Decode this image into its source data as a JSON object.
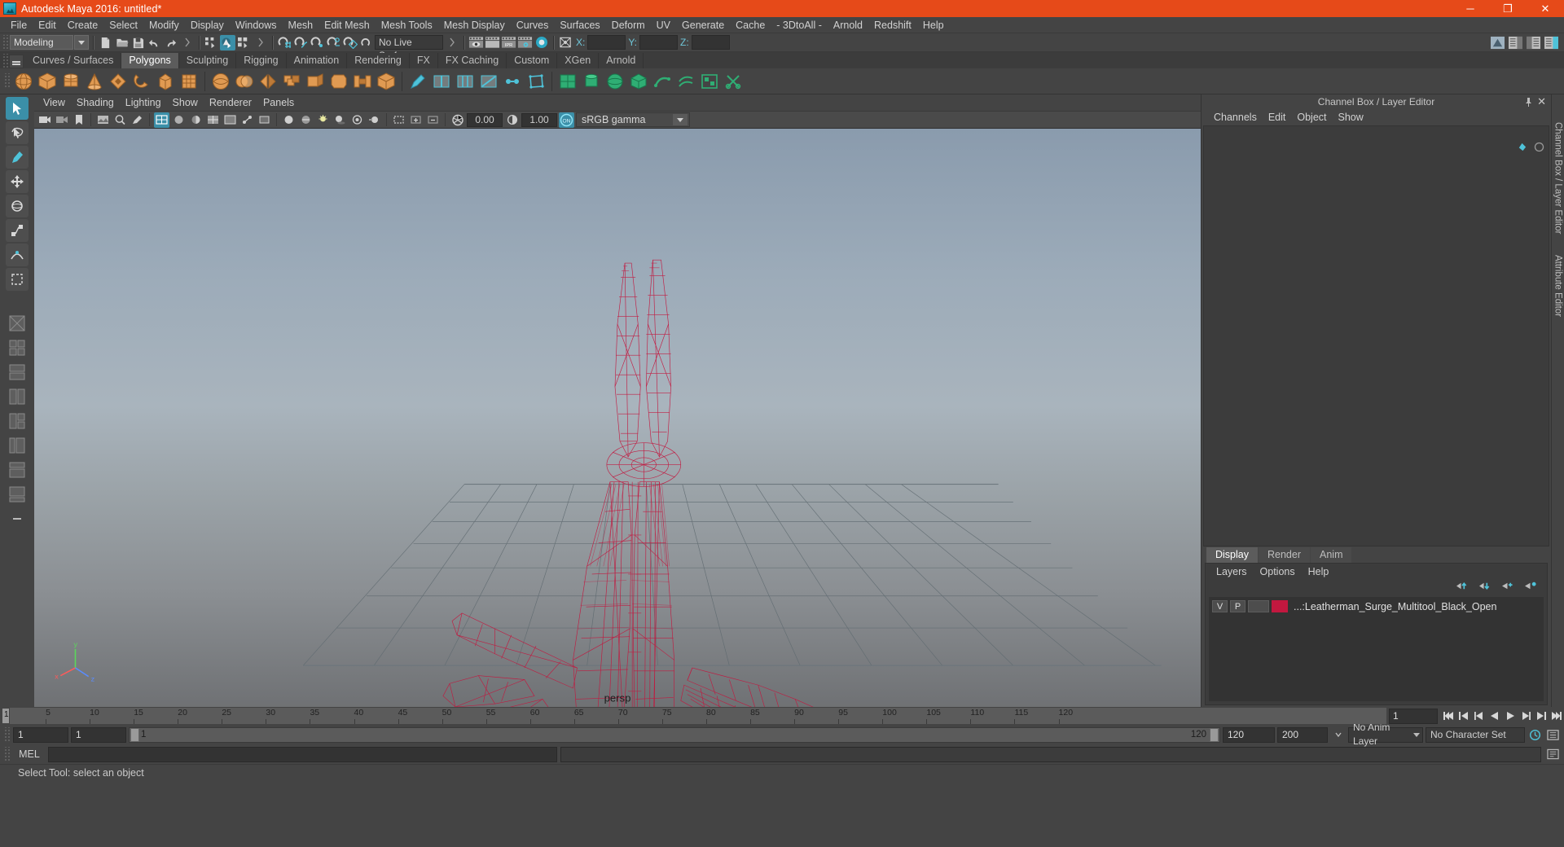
{
  "window": {
    "title": "Autodesk Maya 2016: untitled*",
    "logo_icon": "maya-logo-icon",
    "minimize_label": "─",
    "maximize_label": "❐",
    "close_label": "✕"
  },
  "menubar": {
    "items": [
      "File",
      "Edit",
      "Create",
      "Select",
      "Modify",
      "Display",
      "Windows",
      "Mesh",
      "Edit Mesh",
      "Mesh Tools",
      "Mesh Display",
      "Curves",
      "Surfaces",
      "Deform",
      "UV",
      "Generate",
      "Cache",
      "- 3DtoAll -",
      "Arnold",
      "Redshift",
      "Help"
    ]
  },
  "statusline": {
    "menuset": "Modeling",
    "live_surface": "No Live Surface",
    "coord_x_label": "X:",
    "coord_y_label": "Y:",
    "coord_z_label": "Z:",
    "coord_x_value": "",
    "coord_y_value": "",
    "coord_z_value": "",
    "ipr_label": "IPR"
  },
  "shelf": {
    "tabs": [
      "Curves / Surfaces",
      "Polygons",
      "Sculpting",
      "Rigging",
      "Animation",
      "Rendering",
      "FX",
      "FX Caching",
      "Custom",
      "XGen",
      "Arnold"
    ],
    "active_tab": "Polygons",
    "icon_groups": [
      [
        "poly-sphere",
        "poly-cube",
        "poly-cylinder",
        "poly-cone",
        "poly-torus",
        "poly-plane",
        "poly-disc"
      ],
      [
        "sphere-smooth",
        "cube-smooth",
        "combine",
        "mirror",
        "booleans",
        "extrude",
        "bevel",
        "bridge",
        "append",
        "wedge"
      ],
      [
        "poly-paint",
        "poly-split",
        "insert-edge-loop",
        "offset-edge-loop",
        "multi-cut",
        "target-weld",
        "quad-draw"
      ],
      [
        "uv-auto",
        "uv-cylindrical",
        "uv-planar",
        "uv-spherical",
        "uv-contour",
        "uv-editor",
        "uv-cut"
      ]
    ]
  },
  "toolbox": {
    "tools": [
      "select-tool",
      "lasso-select-tool",
      "paint-select-tool",
      "move-tool",
      "rotate-tool",
      "scale-tool",
      "soft-modification-tool",
      "last-tool-used"
    ],
    "layouts": [
      "single-perspective-view-layout",
      "four-view-layout",
      "two-stacked-layout",
      "two-side-by-side-layout",
      "three-split-layout",
      "outliner-persp-layout",
      "hypershade-persp-layout",
      "persp-graph-layout",
      "more-layouts"
    ],
    "active_tool": "select-tool"
  },
  "viewport": {
    "menu": [
      "View",
      "Shading",
      "Lighting",
      "Show",
      "Renderer",
      "Panels"
    ],
    "camera_label": "persp",
    "exposure": "0.00",
    "gamma": "1.00",
    "color_management": "sRGB gamma",
    "toggle_on_label": "ON",
    "axis": {
      "x": "x",
      "y": "y",
      "z": "z"
    },
    "model_color": "#c2183f",
    "bg_top": "#8a9bad",
    "bg_bottom": "#6e7072"
  },
  "channelbox": {
    "panel_title": "Channel Box / Layer Editor",
    "menu": [
      "Channels",
      "Edit",
      "Object",
      "Show"
    ],
    "pin_icon": "pin-icon",
    "close_icon": "close-icon"
  },
  "layereditor": {
    "tabs": [
      "Display",
      "Render",
      "Anim"
    ],
    "active_tab": "Display",
    "menu": [
      "Layers",
      "Options",
      "Help"
    ],
    "buttons": [
      "move-layer-up-icon",
      "move-layer-down-icon",
      "create-new-layer-icon",
      "create-layer-from-selected-icon"
    ],
    "layers": [
      {
        "visibility": "V",
        "playback": "P",
        "shading": "",
        "color": "#c2183f",
        "name": "...:Leatherman_Surge_Multitool_Black_Open"
      }
    ]
  },
  "rightstrip": {
    "labels": [
      "Channel Box / Layer Editor",
      "Attribute Editor"
    ]
  },
  "timeslider": {
    "ticks": [
      "5",
      "10",
      "15",
      "20",
      "25",
      "30",
      "35",
      "40",
      "45",
      "50",
      "55",
      "60",
      "65",
      "70",
      "75",
      "80",
      "85",
      "90",
      "95",
      "100",
      "105",
      "110",
      "115",
      "120"
    ],
    "current_frame": "1",
    "current_frame_field": "1",
    "transport": [
      "go-to-start-icon",
      "step-back-key-icon",
      "step-back-frame-icon",
      "play-backwards-icon",
      "play-forwards-icon",
      "step-forward-frame-icon",
      "step-forward-key-icon",
      "go-to-end-icon"
    ]
  },
  "rangeslider": {
    "anim_start": "1",
    "range_start": "1",
    "range_label_left": "1",
    "range_label_right": "120",
    "range_end": "120",
    "anim_end": "200",
    "anim_layer": "No Anim Layer",
    "character_set": "No Character Set",
    "auto_key_icon": "auto-keyframe-icon",
    "anim_prefs_icon": "animation-preferences-icon"
  },
  "commandline": {
    "label": "MEL",
    "input_value": "",
    "output_value": "",
    "script_editor_icon": "script-editor-icon"
  },
  "helpline": {
    "text": "Select Tool: select an object"
  }
}
